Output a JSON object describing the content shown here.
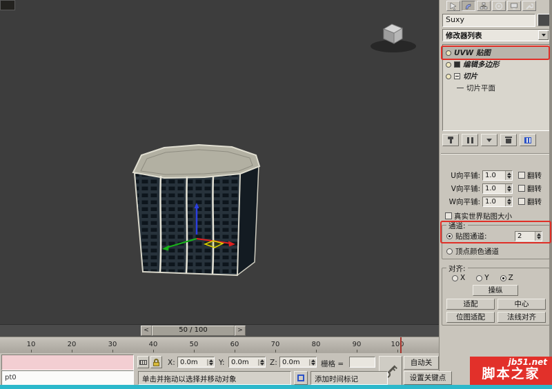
{
  "viewport": {
    "time_slider_value": "50 / 100",
    "prev_label": "<",
    "next_label": ">"
  },
  "timeline": {
    "ticks": [
      "10",
      "20",
      "30",
      "40",
      "50",
      "60",
      "70",
      "80",
      "90",
      "100"
    ]
  },
  "panel": {
    "object_name": "Suxy",
    "modifier_list_label": "修改器列表",
    "stack": [
      {
        "label": "UVW 贴图"
      },
      {
        "label": "编辑多边形"
      },
      {
        "label": "切片"
      },
      {
        "label": "切片平面"
      }
    ],
    "params": {
      "u_label": "U向平铺:",
      "u_value": "1.0",
      "v_label": "V向平铺:",
      "v_value": "1.0",
      "w_label": "W向平铺:",
      "w_value": "1.0",
      "flip_label": "翻转",
      "real_world_label": "真实世界贴图大小"
    },
    "channel": {
      "title": "通道:",
      "map_channel_label": "贴图通道:",
      "map_channel_value": "2",
      "vertex_color_label": "顶点颜色通道"
    },
    "align": {
      "title": "对齐:",
      "x_label": "X",
      "y_label": "Y",
      "z_label": "Z",
      "manipulate_label": "操纵",
      "fit_label": "适配",
      "center_label": "中心",
      "bitmap_fit_label": "位图适配",
      "normal_align_label": "法线对齐"
    }
  },
  "statusbar": {
    "listener_text": "pt0",
    "x_label": "X:",
    "x_value": "0.0m",
    "y_label": "Y:",
    "y_value": "0.0m",
    "z_label": "Z:",
    "z_value": "0.0m",
    "grid_label": "栅格 =",
    "prompt_text": "单击并拖动以选择并移动对象",
    "time_tag_label": "添加时间标记",
    "auto_key_label": "自动关",
    "set_key_label": "设置关键点"
  },
  "watermark": {
    "site": "jb51.net",
    "name": "脚本之家"
  },
  "colors": {
    "annotation_red": "#e02f27",
    "watermark_red": "#e2302a",
    "strip_teal": "#2cb8cb"
  }
}
